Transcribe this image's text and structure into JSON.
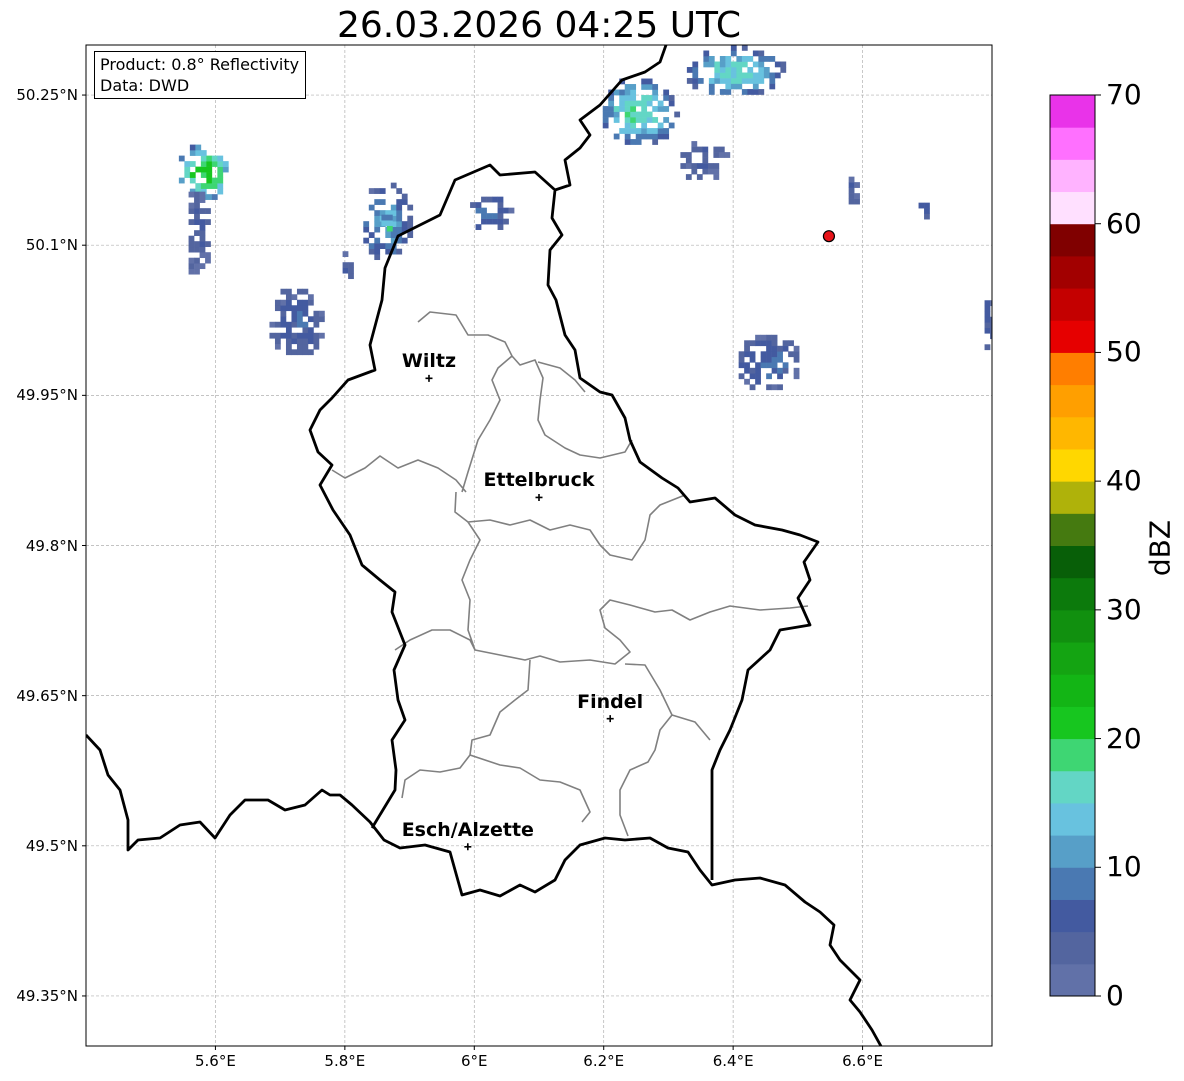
{
  "title": "26.03.2026 04:25 UTC",
  "info": {
    "product": "Product: 0.8° Reflectivity",
    "source": "Data: DWD"
  },
  "map": {
    "lon_range": [
      5.4,
      6.8
    ],
    "lat_range": [
      49.3,
      50.3
    ],
    "lon_ticks": [
      {
        "value": 5.6,
        "label": "5.6°E"
      },
      {
        "value": 5.8,
        "label": "5.8°E"
      },
      {
        "value": 6.0,
        "label": "6°E"
      },
      {
        "value": 6.2,
        "label": "6.2°E"
      },
      {
        "value": 6.4,
        "label": "6.4°E"
      },
      {
        "value": 6.6,
        "label": "6.6°E"
      }
    ],
    "lat_ticks": [
      {
        "value": 50.25,
        "label": "50.25°N"
      },
      {
        "value": 50.1,
        "label": "50.1°N"
      },
      {
        "value": 49.95,
        "label": "49.95°N"
      },
      {
        "value": 49.8,
        "label": "49.8°N"
      },
      {
        "value": 49.65,
        "label": "49.65°N"
      },
      {
        "value": 49.5,
        "label": "49.5°N"
      },
      {
        "value": 49.35,
        "label": "49.35°N"
      }
    ],
    "gridlines": true,
    "cities": [
      {
        "name": "Wiltz",
        "lon": 5.93,
        "lat": 49.967
      },
      {
        "name": "Ettelbruck",
        "lon": 6.1,
        "lat": 49.848
      },
      {
        "name": "Findel",
        "lon": 6.21,
        "lat": 49.627
      },
      {
        "name": "Esch/Alzette",
        "lon": 5.99,
        "lat": 49.499
      }
    ],
    "radar_site": {
      "lon": 6.548,
      "lat": 50.109,
      "color": "#e8141a"
    },
    "echo_cells": [
      {
        "lon": 5.58,
        "lat": 50.17,
        "rlon": 0.045,
        "rlat": 0.03,
        "dbz": 22
      },
      {
        "lon": 5.57,
        "lat": 50.11,
        "rlon": 0.02,
        "rlat": 0.05,
        "dbz": 5
      },
      {
        "lon": 5.86,
        "lat": 50.12,
        "rlon": 0.04,
        "rlat": 0.04,
        "dbz": 12
      },
      {
        "lon": 5.86,
        "lat": 50.115,
        "rlon": 0.012,
        "rlat": 0.012,
        "dbz": 20
      },
      {
        "lon": 5.72,
        "lat": 50.02,
        "rlon": 0.045,
        "rlat": 0.035,
        "dbz": 7
      },
      {
        "lon": 6.02,
        "lat": 50.13,
        "rlon": 0.035,
        "rlat": 0.02,
        "dbz": 8
      },
      {
        "lon": 6.25,
        "lat": 50.23,
        "rlon": 0.06,
        "rlat": 0.035,
        "dbz": 18
      },
      {
        "lon": 6.4,
        "lat": 50.27,
        "rlon": 0.08,
        "rlat": 0.025,
        "dbz": 16
      },
      {
        "lon": 6.35,
        "lat": 50.18,
        "rlon": 0.04,
        "rlat": 0.02,
        "dbz": 5
      },
      {
        "lon": 6.45,
        "lat": 49.98,
        "rlon": 0.05,
        "rlat": 0.03,
        "dbz": 8
      },
      {
        "lon": 6.58,
        "lat": 50.15,
        "rlon": 0.01,
        "rlat": 0.02,
        "dbz": 5
      },
      {
        "lon": 6.79,
        "lat": 50.02,
        "rlon": 0.01,
        "rlat": 0.03,
        "dbz": 6
      },
      {
        "lon": 5.8,
        "lat": 50.07,
        "rlon": 0.012,
        "rlat": 0.02,
        "dbz": 5
      },
      {
        "lon": 6.69,
        "lat": 50.13,
        "rlon": 0.012,
        "rlat": 0.015,
        "dbz": 5
      }
    ]
  },
  "colorbar": {
    "label": "dBZ",
    "min": 0,
    "max": 70,
    "step": 2.5,
    "colors": [
      "#6171a8",
      "#53659f",
      "#435aa0",
      "#4a79b2",
      "#579fc8",
      "#68c2df",
      "#63d6c5",
      "#3ed673",
      "#17c61f",
      "#13b515",
      "#14a412",
      "#11900f",
      "#0c7a0c",
      "#085f08",
      "#457a10",
      "#afb20a",
      "#ffd700",
      "#ffb700",
      "#ff9f00",
      "#ff7e00",
      "#e60000",
      "#c40000",
      "#a20000",
      "#800000",
      "#ffe0ff",
      "#ffb3ff",
      "#ff70ff",
      "#e933e9"
    ],
    "ticks": [
      {
        "value": 0,
        "label": "0"
      },
      {
        "value": 10,
        "label": "10"
      },
      {
        "value": 20,
        "label": "20"
      },
      {
        "value": 30,
        "label": "30"
      },
      {
        "value": 40,
        "label": "40"
      },
      {
        "value": 50,
        "label": "50"
      },
      {
        "value": 60,
        "label": "60"
      },
      {
        "value": 70,
        "label": "70"
      }
    ]
  }
}
